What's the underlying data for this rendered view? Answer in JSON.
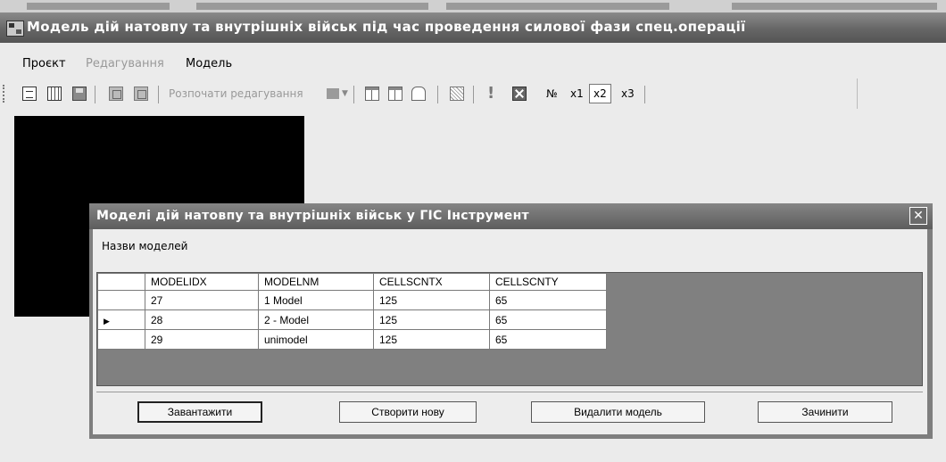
{
  "window": {
    "title": "Модель дій натовпу та внутрішніх військ під час проведення силової фази спец.операції"
  },
  "menu": [
    {
      "label": "Проєкт",
      "enabled": true
    },
    {
      "label": "Редагування",
      "enabled": false
    },
    {
      "label": "Модель",
      "enabled": true
    }
  ],
  "toolbar": {
    "start_edit_label": "Розпочати редагування",
    "number_label": "№",
    "zoom_x1": "x1",
    "zoom_x2": "x2",
    "zoom_x3": "x3",
    "zoom_selected": "x2"
  },
  "dialog": {
    "title": "Моделі дій натовпу та внутрішніх військ у ГІС Інструмент",
    "list_label": "Назви моделей",
    "columns": [
      "MODELIDX",
      "MODELNM",
      "CELLSCNTX",
      "CELLSCNTY"
    ],
    "rows": [
      {
        "cells": [
          "27",
          "1 Model",
          "125",
          "65"
        ],
        "current": false
      },
      {
        "cells": [
          "28",
          "2 - Model",
          "125",
          "65"
        ],
        "current": true
      },
      {
        "cells": [
          "29",
          "unimodel",
          "125",
          "65"
        ],
        "current": false
      }
    ],
    "buttons": {
      "load": "Завантажити",
      "create": "Створити нову",
      "delete": "Видалити модель",
      "close": "Зачинити"
    },
    "close_glyph": "✕"
  }
}
